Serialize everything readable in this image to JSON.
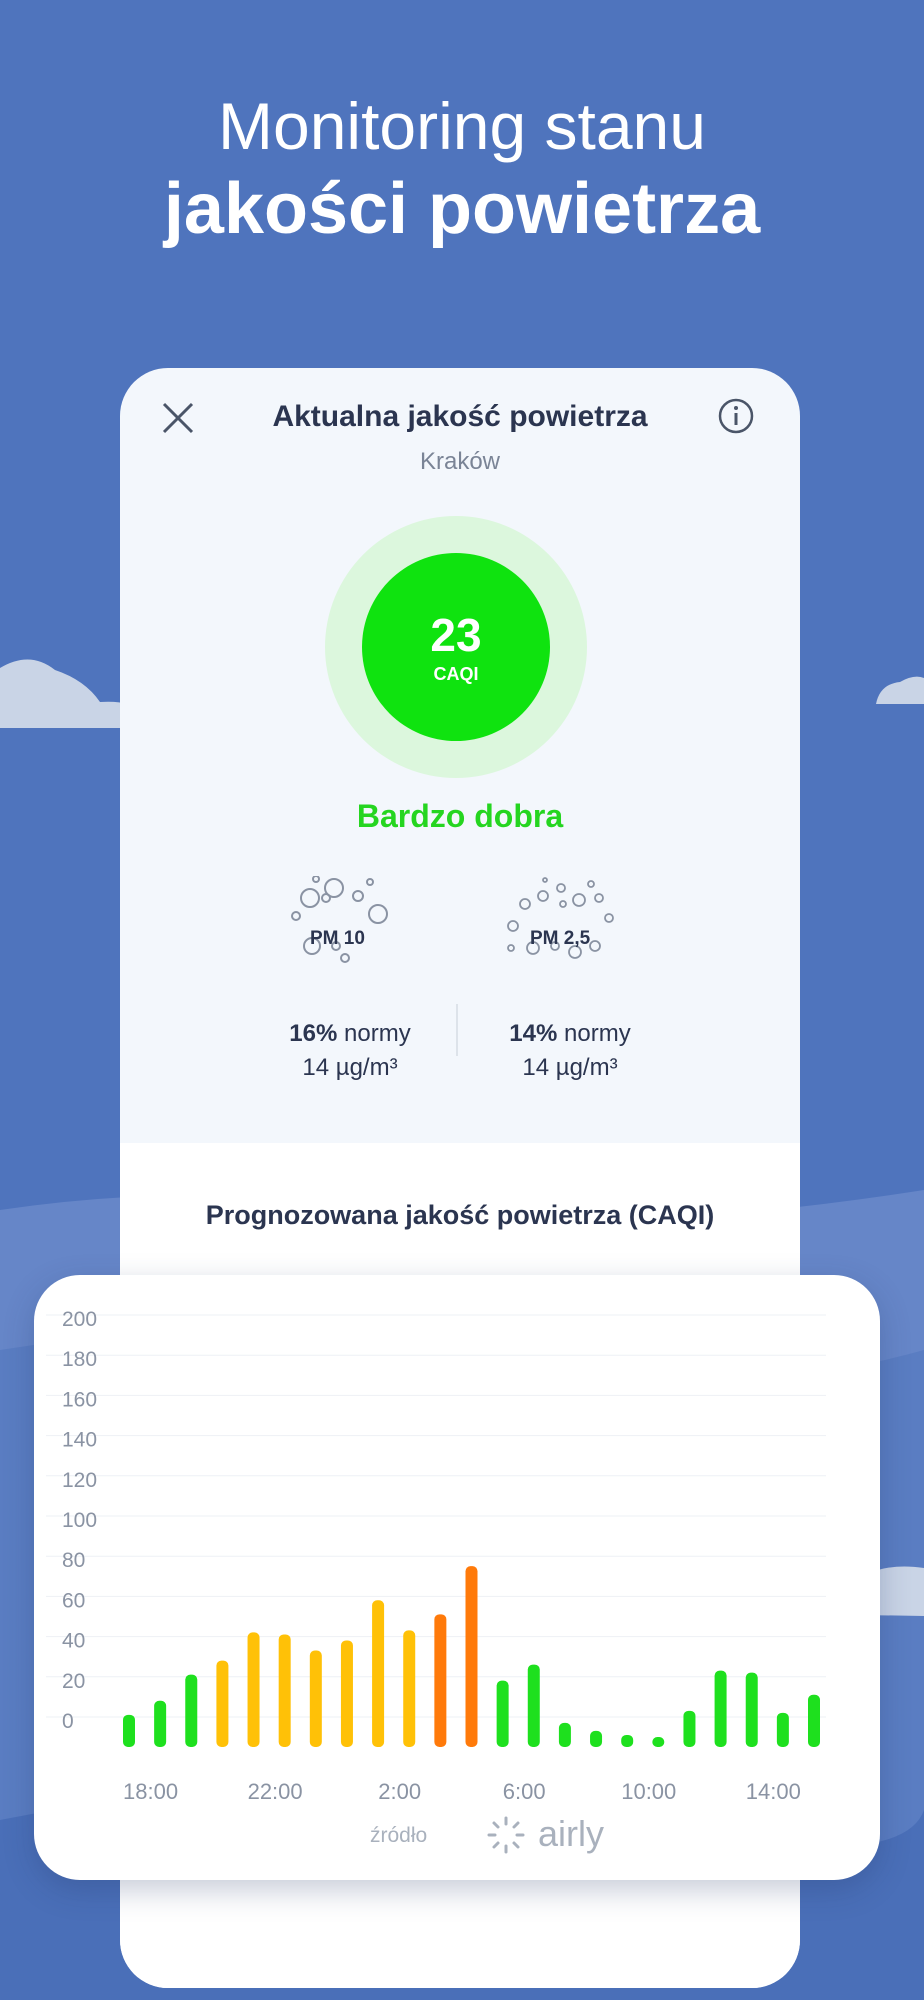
{
  "hero": {
    "line1": "Monitoring stanu",
    "line2": "jakości powietrza"
  },
  "panel": {
    "title": "Aktualna jakość powietrza",
    "city": "Kraków",
    "close_icon": "close-icon",
    "info_icon": "info-icon"
  },
  "gauge": {
    "value": "23",
    "unit": "CAQI",
    "quality": "Bardzo dobra",
    "color": "#0fe30f"
  },
  "pm10": {
    "label": "PM 10",
    "percent": "16%",
    "norm_word": " normy",
    "concentration": "14  µg/m³"
  },
  "pm25": {
    "label": "PM 2,5",
    "percent": "14%",
    "norm_word": " normy",
    "concentration": "14  µg/m³"
  },
  "forecast": {
    "title": "Prognozowana jakość powietrza (CAQI)"
  },
  "source": {
    "label": "źródło",
    "brand": "airly"
  },
  "colors": {
    "background": "#4f74bd",
    "good": "#1ee01e",
    "moderate": "#ffc107",
    "poor": "#ff7a0a",
    "text_dark": "#2b3550"
  },
  "chart_data": {
    "type": "bar",
    "title": "Prognozowana jakość powietrza (CAQI)",
    "ylim": [
      0,
      200
    ],
    "y_ticks": [
      200,
      180,
      160,
      140,
      120,
      100,
      80,
      60,
      40,
      20,
      0
    ],
    "x_tick_labels": [
      "18:00",
      "22:00",
      "2:00",
      "6:00",
      "10:00",
      "14:00"
    ],
    "x_tick_positions": [
      1,
      5,
      9,
      13,
      17,
      21
    ],
    "grid": true,
    "values": [
      16,
      23,
      36,
      43,
      57,
      56,
      48,
      53,
      73,
      58,
      66,
      90,
      33,
      41,
      12,
      8,
      6,
      0,
      18,
      38,
      37,
      17,
      26
    ],
    "colors": [
      "#1ee01e",
      "#1ee01e",
      "#1ee01e",
      "#ffc107",
      "#ffc107",
      "#ffc107",
      "#ffc107",
      "#ffc107",
      "#ffc107",
      "#ffc107",
      "#ff7a0a",
      "#ff7a0a",
      "#1ee01e",
      "#1ee01e",
      "#1ee01e",
      "#1ee01e",
      "#1ee01e",
      "#1ee01e",
      "#1ee01e",
      "#1ee01e",
      "#1ee01e",
      "#1ee01e",
      "#1ee01e"
    ]
  }
}
